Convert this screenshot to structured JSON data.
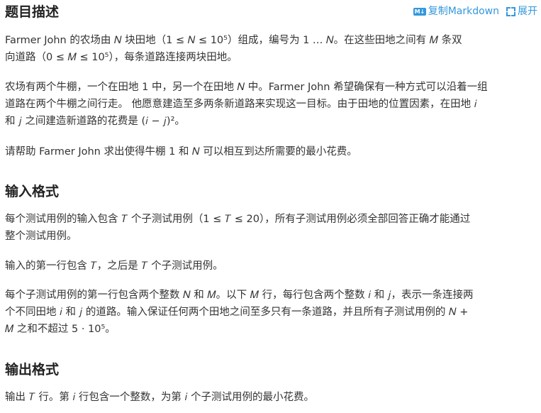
{
  "header": {
    "title": "题目描述",
    "copy_markdown": "复制Markdown",
    "md_badge": "M↓",
    "expand": "展开"
  },
  "description": {
    "p1": [
      "Farmer John 的农场由 𝑁 块田地（1 ≤ 𝑁 ≤ 10⁵）组成，编号为 1 … 𝑁。在这些田地之间有 𝑀 条双",
      "向道路（0 ≤ 𝑀 ≤ 10⁵），每条道路连接两块田地。"
    ],
    "p2": [
      "农场有两个牛棚，一个在田地 1 中，另一个在田地 𝑁 中。Farmer John 希望确保有一种方式可以沿着一组",
      "道路在两个牛棚之间行走。 他愿意建造至多两条新道路来实现这一目标。由于田地的位置因素，在田地 𝑖",
      "和 𝑗 之间建造新道路的花费是 (𝑖 − 𝑗)²。"
    ],
    "p3": [
      "请帮助 Farmer John 求出使得牛棚 1 和 𝑁 可以相互到达所需要的最小花费。"
    ]
  },
  "input_format": {
    "title": "输入格式",
    "p1": [
      "每个测试用例的输入包含 𝑇 个子测试用例（1 ≤ 𝑇 ≤ 20），所有子测试用例必须全部回答正确才能通过",
      "整个测试用例。"
    ],
    "p2": [
      "输入的第一行包含 𝑇，之后是 𝑇 个子测试用例。"
    ],
    "p3": [
      "每个子测试用例的第一行包含两个整数 𝑁 和 𝑀。以下 𝑀 行，每行包含两个整数 𝑖 和 𝑗，表示一条连接两",
      "个不同田地 𝑖 和 𝑗 的道路。输入保证任何两个田地之间至多只有一条道路，并且所有子测试用例的 𝑁 +",
      "𝑀 之和不超过 5 · 10⁵。"
    ]
  },
  "output_format": {
    "title": "输出格式",
    "p1": [
      "输出 𝑇 行。第 𝑖 行包含一个整数，为第 𝑖 个子测试用例的最小花费。"
    ]
  }
}
